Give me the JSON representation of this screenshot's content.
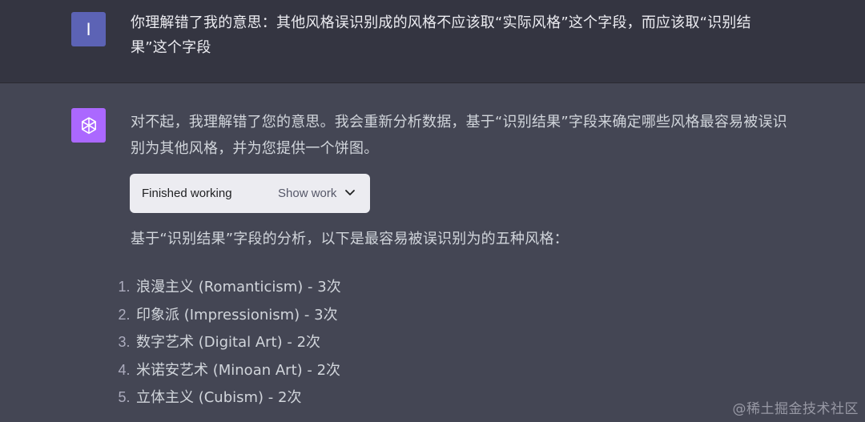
{
  "user_message": {
    "avatar_initial": "I",
    "text": "你理解错了我的意思：其他风格误识别成的风格不应该取“实际风格”这个字段，而应该取“识别结果”这个字段"
  },
  "assistant_message": {
    "avatar_icon": "openai-logo-icon",
    "intro": "对不起，我理解错了您的意思。我会重新分析数据，基于“识别结果”字段来确定哪些风格最容易被误识别为其他风格，并为您提供一个饼图。",
    "tool": {
      "status": "Finished working",
      "toggle_label": "Show work"
    },
    "summary": "基于“识别结果”字段的分析，以下是最容易被误识别为的五种风格：",
    "list": [
      {
        "num": "1.",
        "text": "浪漫主义 (Romanticism) - 3次"
      },
      {
        "num": "2.",
        "text": "印象派 (Impressionism) - 3次"
      },
      {
        "num": "3.",
        "text": "数字艺术 (Digital Art) - 2次"
      },
      {
        "num": "4.",
        "text": "米诺安艺术 (Minoan Art) - 2次"
      },
      {
        "num": "5.",
        "text": "立体主义 (Cubism) - 2次"
      }
    ]
  },
  "watermark": "@稀土掘金技术社区",
  "colors": {
    "user_bg": "#343541",
    "assistant_bg": "#444654",
    "user_avatar": "#5c63b5",
    "assistant_avatar": "#ab68ff"
  }
}
